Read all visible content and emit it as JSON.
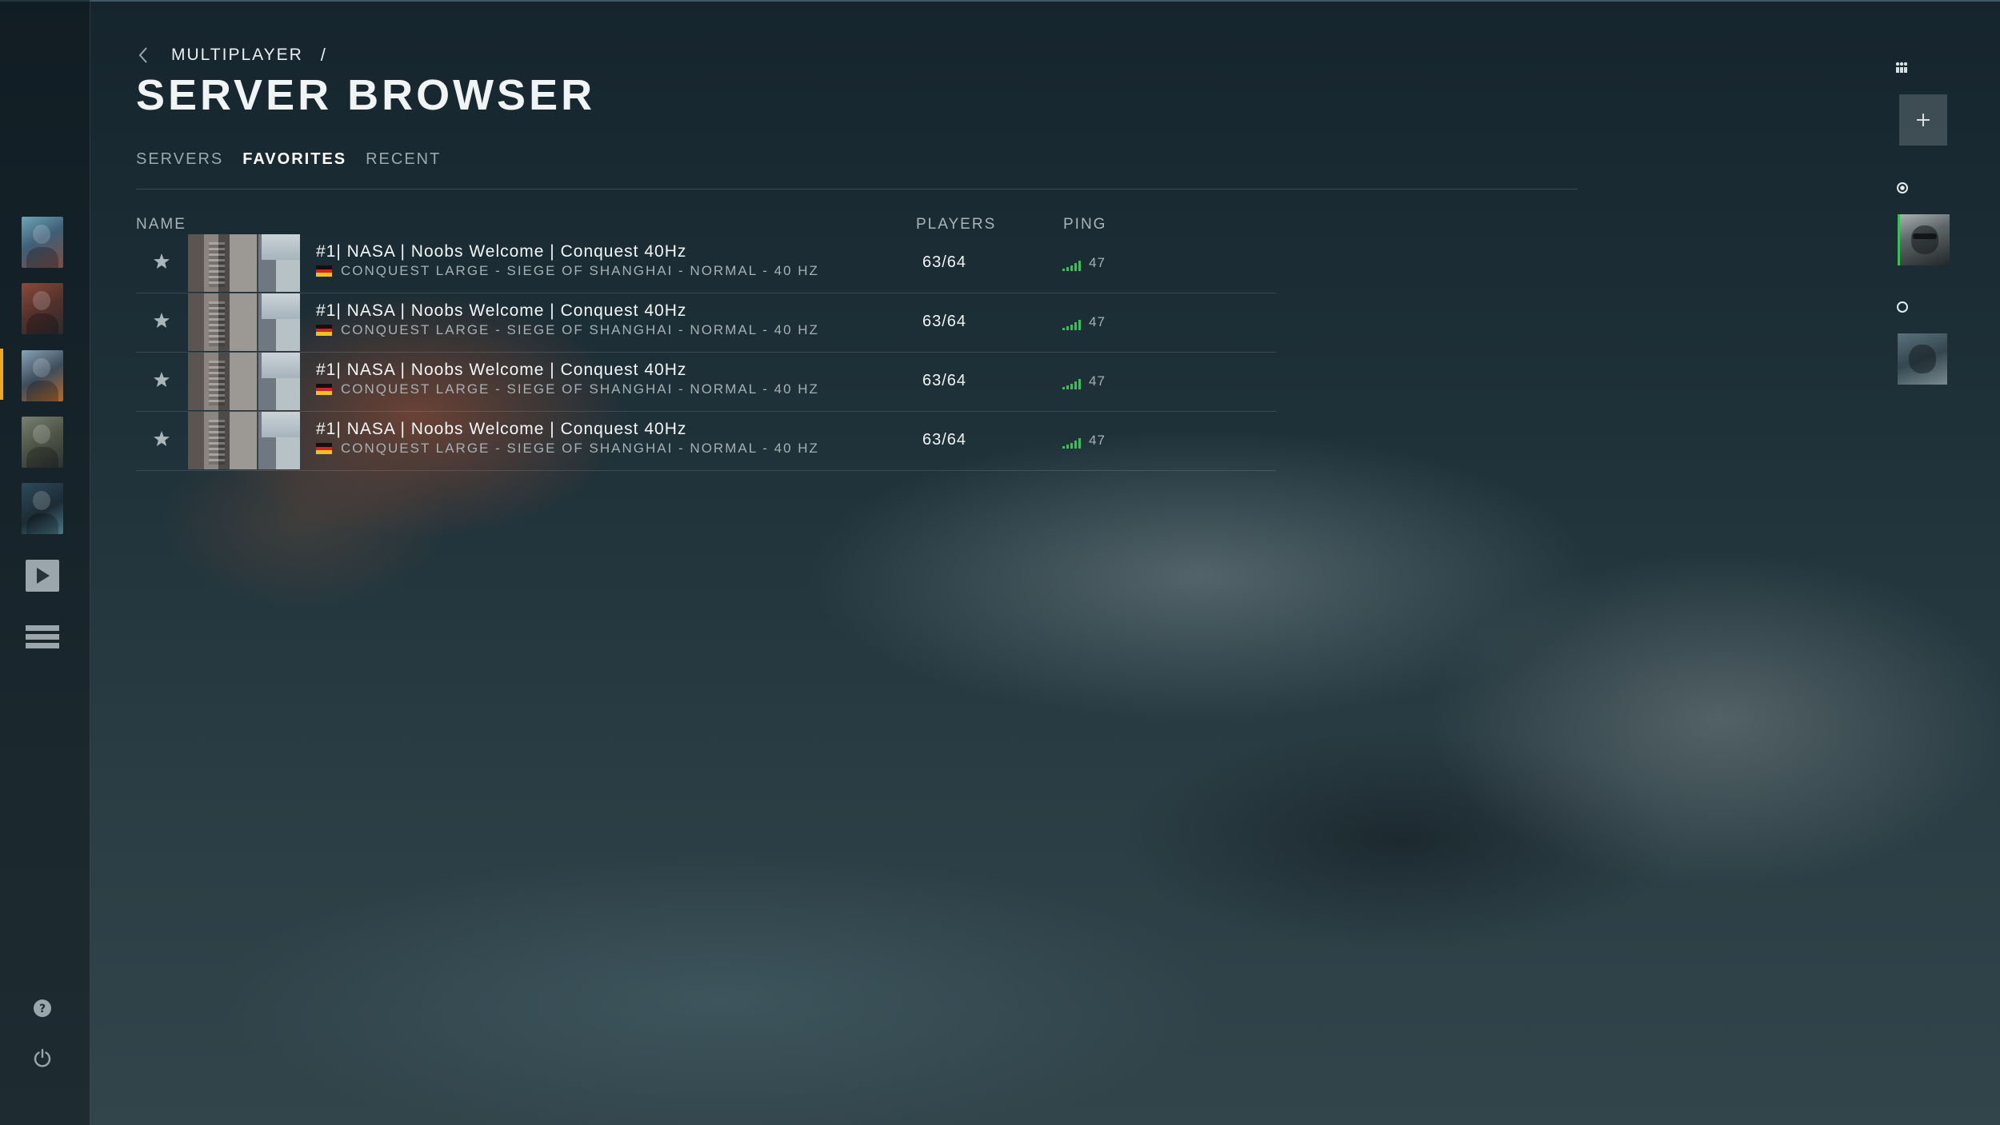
{
  "breadcrumb": {
    "parent": "MULTIPLAYER",
    "separator": "/"
  },
  "page_title": "SERVER BROWSER",
  "tabs": [
    {
      "label": "SERVERS",
      "active": false
    },
    {
      "label": "FAVORITES",
      "active": true
    },
    {
      "label": "RECENT",
      "active": false
    }
  ],
  "columns": {
    "name": "NAME",
    "players": "PLAYERS",
    "ping": "PING"
  },
  "servers": [
    {
      "name": "#1| NASA | Noobs Welcome | Conquest 40Hz",
      "details": "CONQUEST LARGE - SIEGE OF SHANGHAI - NORMAL - 40 HZ",
      "players": "63/64",
      "ping": "47",
      "favorite": true,
      "flag": "germany"
    },
    {
      "name": "#1| NASA | Noobs Welcome | Conquest 40Hz",
      "details": "CONQUEST LARGE - SIEGE OF SHANGHAI - NORMAL - 40 HZ",
      "players": "63/64",
      "ping": "47",
      "favorite": true,
      "flag": "germany"
    },
    {
      "name": "#1| NASA | Noobs Welcome | Conquest 40Hz",
      "details": "CONQUEST LARGE - SIEGE OF SHANGHAI - NORMAL - 40 HZ",
      "players": "63/64",
      "ping": "47",
      "favorite": true,
      "flag": "germany"
    },
    {
      "name": "#1| NASA | Noobs Welcome | Conquest 40Hz",
      "details": "CONQUEST LARGE - SIEGE OF SHANGHAI - NORMAL - 40 HZ",
      "players": "63/64",
      "ping": "47",
      "favorite": true,
      "flag": "germany"
    }
  ],
  "sidebar": {
    "items": [
      "soldier-portrait-1",
      "soldier-portrait-2",
      "soldier-portrait-3",
      "soldier-portrait-4",
      "soldier-portrait-5",
      "play-icon",
      "menu-icon"
    ],
    "active_index": 2,
    "footer_icons": [
      "help-icon",
      "power-icon"
    ]
  },
  "squad": {
    "icons": [
      "squad-icon",
      "add-icon"
    ],
    "members": 2
  },
  "colors": {
    "accent": "#f0a81e",
    "ping_good": "#3cbf55",
    "text": "#f1f4f5",
    "muted": "#a6b1b5"
  }
}
